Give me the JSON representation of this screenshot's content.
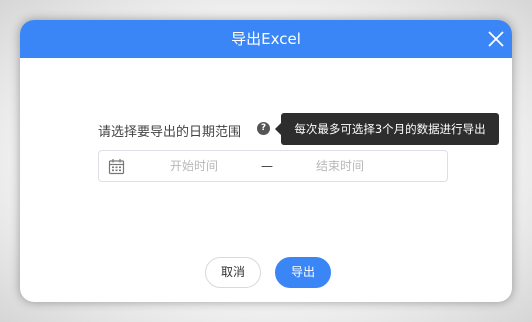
{
  "colors": {
    "accent": "#3b86f6",
    "tooltip_bg": "#2d2d2d",
    "placeholder": "#b8b8b8"
  },
  "dialog": {
    "title": "导出Excel",
    "close_icon": "close-icon"
  },
  "form": {
    "label": "请选择要导出的日期范围",
    "help_icon": "question-circle-icon",
    "help_glyph": "?",
    "tooltip": "每次最多可选择3个月的数据进行导出",
    "date_range": {
      "icon": "calendar-icon",
      "start_placeholder": "开始时间",
      "separator": "—",
      "end_placeholder": "结束时间"
    }
  },
  "footer": {
    "cancel_label": "取消",
    "export_label": "导出"
  }
}
